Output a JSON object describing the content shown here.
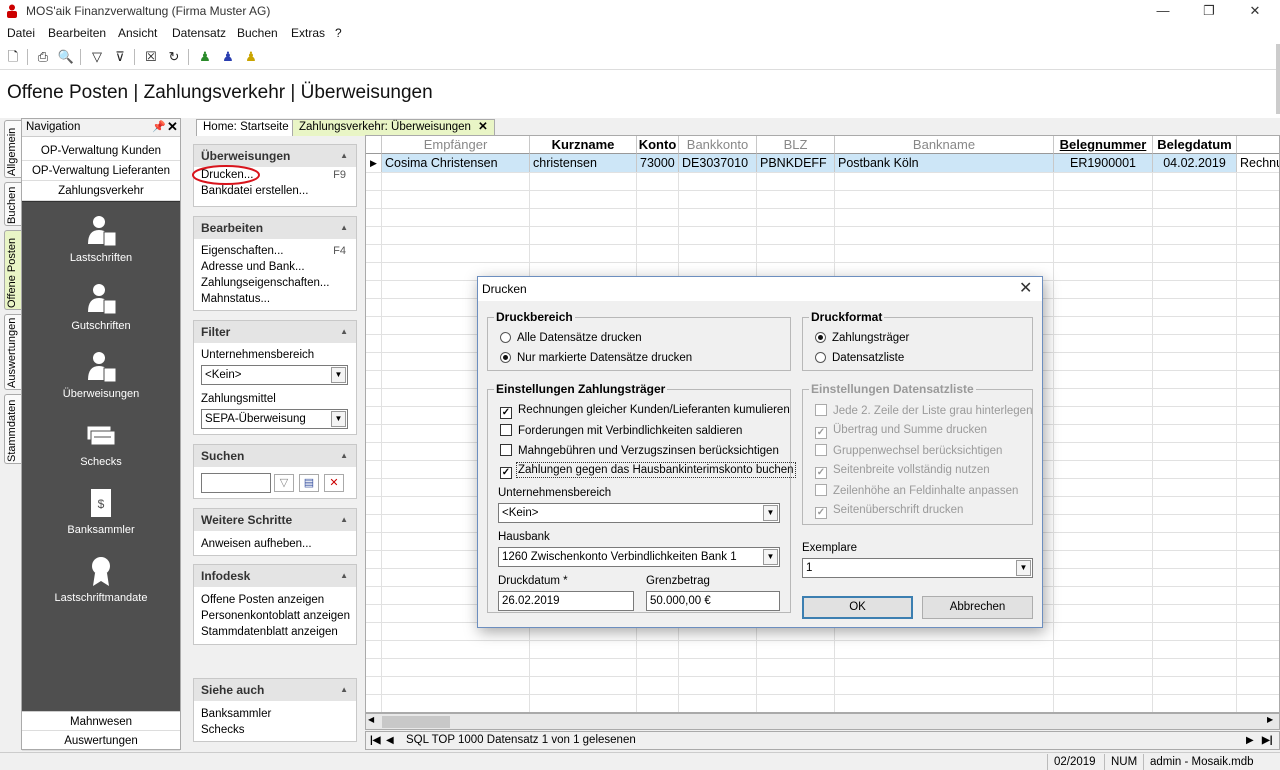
{
  "window": {
    "title": "MOS'aik Finanzverwaltung (Firma Muster AG)",
    "minimize": "—",
    "maximize": "❐",
    "close": "✕"
  },
  "menu": [
    "Datei",
    "Bearbeiten",
    "Ansicht",
    "Datensatz",
    "Buchen",
    "Extras",
    "?"
  ],
  "page_title": "Offene Posten | Zahlungsverkehr | Überweisungen",
  "vertical_tabs": [
    "Allgemein",
    "Buchen",
    "Offene Posten",
    "Auswertungen",
    "Stammdaten"
  ],
  "navigation": {
    "header": "Navigation",
    "items_top": [
      "OP-Verwaltung Kunden",
      "OP-Verwaltung Lieferanten",
      "Zahlungsverkehr"
    ],
    "big_items": [
      "Lastschriften",
      "Gutschriften",
      "Überweisungen",
      "Schecks",
      "Banksammler",
      "Lastschriftmandate"
    ],
    "items_bottom": [
      "Mahnwesen",
      "Auswertungen"
    ]
  },
  "tasks": {
    "ueberweisungen": {
      "title": "Überweisungen",
      "drucken": "Drucken...",
      "drucken_key": "F9",
      "bankdatei": "Bankdatei erstellen..."
    },
    "bearbeiten": {
      "title": "Bearbeiten",
      "eigenschaften": "Eigenschaften...",
      "eigenschaften_key": "F4",
      "adresse": "Adresse und Bank...",
      "zahlungseig": "Zahlungseigenschaften...",
      "mahnstatus": "Mahnstatus..."
    },
    "filter": {
      "title": "Filter",
      "ub_label": "Unternehmensbereich",
      "ub_value": "<Kein>",
      "zm_label": "Zahlungsmittel",
      "zm_value": "SEPA-Überweisung"
    },
    "suchen": {
      "title": "Suchen"
    },
    "weitere": {
      "title": "Weitere Schritte",
      "anweisen": "Anweisen aufheben..."
    },
    "infodesk": {
      "title": "Infodesk",
      "op": "Offene Posten anzeigen",
      "personen": "Personenkontoblatt anzeigen",
      "stamm": "Stammdatenblatt anzeigen"
    },
    "siehe": {
      "title": "Siehe auch",
      "banksammler": "Banksammler",
      "schecks": "Schecks"
    }
  },
  "doc_tabs": {
    "home": "Home: Startseite",
    "active": "Zahlungsverkehr: Überweisungen",
    "close": "✕"
  },
  "grid": {
    "columns": [
      "Empfänger",
      "Kurzname",
      "Konto",
      "Bankkonto",
      "BLZ",
      "Bankname",
      "Belegnummer",
      "Belegdatum"
    ],
    "row": [
      "Cosima Christensen",
      "christensen",
      "73000",
      "DE3037010",
      "PBNKDEFF",
      "Postbank Köln",
      "ER1900001",
      "04.02.2019",
      "Rechnu"
    ]
  },
  "recbar": {
    "text": "SQL TOP 1000 Datensatz 1 von 1 gelesenen"
  },
  "statusbar": {
    "period": "02/2019",
    "num": "NUM",
    "user": "admin - Mosaik.mdb"
  },
  "dialog": {
    "title": "Drucken",
    "druckbereich": {
      "title": "Druckbereich",
      "alle": "Alle Datensätze drucken",
      "markierte": "Nur markierte Datensätze drucken"
    },
    "druckformat": {
      "title": "Druckformat",
      "zahlungstraeger": "Zahlungsträger",
      "datensatzliste": "Datensatzliste"
    },
    "einst_zt": {
      "title": "Einstellungen Zahlungsträger",
      "c1": "Rechnungen gleicher Kunden/Lieferanten kumulieren",
      "c2": "Forderungen mit Verbindlichkeiten saldieren",
      "c3": "Mahngebühren und Verzugszinsen berücksichtigen",
      "c4": "Zahlungen gegen das Hausbankinterimskonto buchen",
      "ub_label": "Unternehmensbereich",
      "ub_value": "<Kein>",
      "hb_label": "Hausbank",
      "hb_value": "1260 Zwischenkonto Verbindlichkeiten Bank 1",
      "dd_label": "Druckdatum *",
      "dd_value": "26.02.2019",
      "gb_label": "Grenzbetrag",
      "gb_value": "50.000,00 €"
    },
    "einst_dl": {
      "title": "Einstellungen Datensatzliste",
      "c1": "Jede 2. Zeile der Liste grau hinterlegen",
      "c2": "Übertrag und Summe drucken",
      "c3": "Gruppenwechsel berücksichtigen",
      "c4": "Seitenbreite vollständig nutzen",
      "c5": "Zeilenhöhe an Feldinhalte anpassen",
      "c6": "Seitenüberschrift drucken"
    },
    "exemplare_label": "Exemplare",
    "exemplare_value": "1",
    "ok": "OK",
    "cancel": "Abbrechen"
  }
}
